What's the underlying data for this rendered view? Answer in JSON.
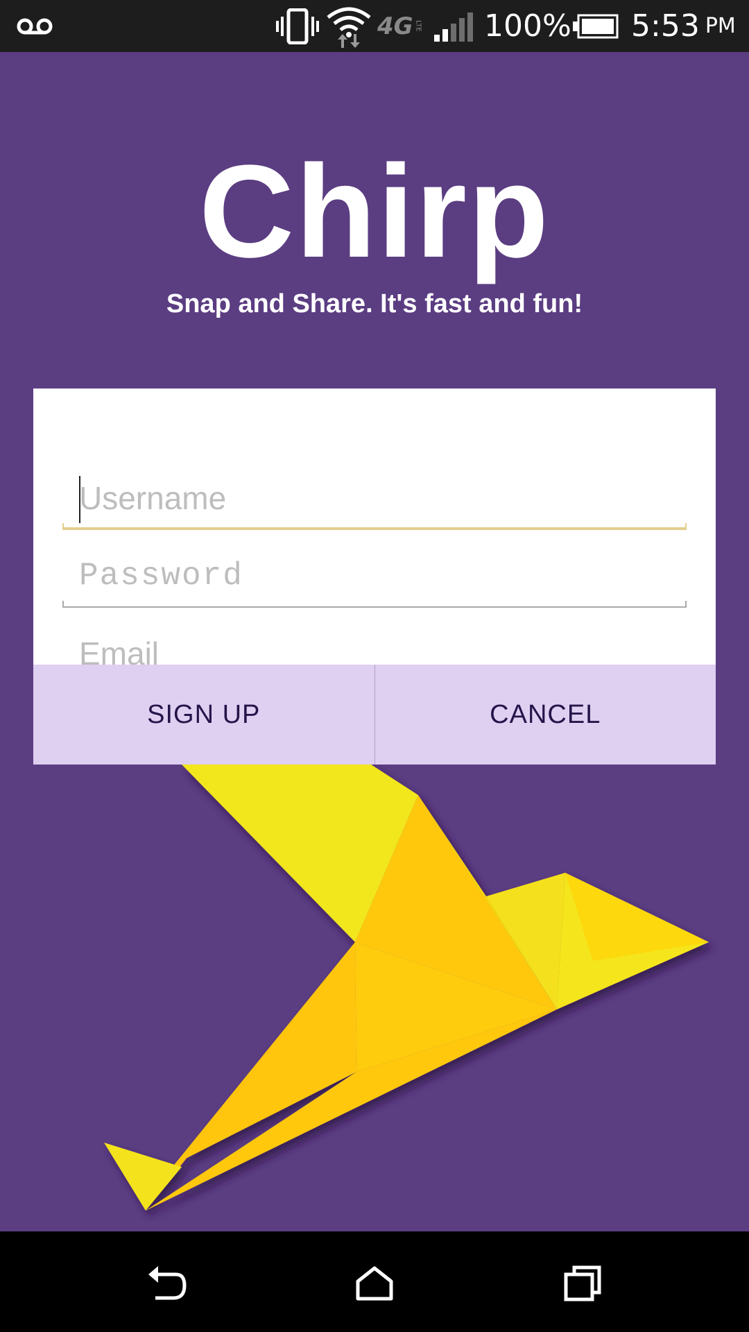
{
  "status_bar": {
    "voicemail_icon": "voicemail-icon",
    "vibrate_icon": "vibrate-icon",
    "wifi_icon": "wifi-icon",
    "network_type": "4G",
    "network_sub": "LTE",
    "signal_icon": "signal-icon",
    "battery_percent": "100%",
    "battery_icon": "battery-icon",
    "time": "5:53",
    "time_suffix": "PM"
  },
  "app": {
    "title": "Chirp",
    "tagline": "Snap and Share. It's fast and fun!"
  },
  "form": {
    "username": {
      "value": "",
      "placeholder": "Username"
    },
    "password": {
      "value": "",
      "placeholder": "Password"
    },
    "email": {
      "value": "",
      "placeholder": "Email"
    },
    "signup_label": "SIGN UP",
    "cancel_label": "CANCEL"
  },
  "nav_bar": {
    "back_icon": "back-icon",
    "home_icon": "home-icon",
    "recents_icon": "recents-icon"
  },
  "colors": {
    "background": "#5b3d82",
    "card": "#ffffff",
    "button_row": "#dfcff1",
    "button_text": "#24154a",
    "active_underline": "#e3cf8e",
    "bird_yellow": "#f5e51a",
    "bird_orange": "#ffc60a"
  }
}
